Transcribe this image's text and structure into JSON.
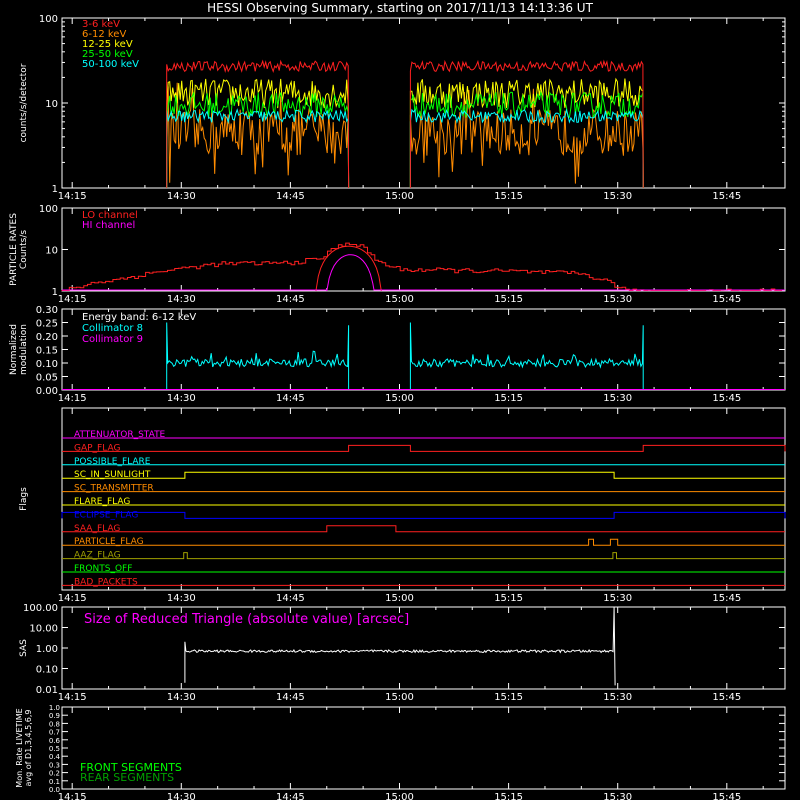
{
  "title": "HESSI Observing Summary, starting on 2017/11/13 14:13:36 UT",
  "colors": {
    "red": "#ff2020",
    "orange": "#ff8c00",
    "yellow": "#ffff00",
    "green": "#00ff00",
    "cyan": "#00ffff",
    "magenta": "#ff00ff",
    "blue": "#0000ff",
    "white": "#ffffff",
    "olive": "#a0a000",
    "darkgreen": "#00a000"
  },
  "time_ticks": [
    "14:15",
    "14:30",
    "14:45",
    "15:00",
    "15:15",
    "15:30",
    "15:45"
  ],
  "chart_data": [
    {
      "id": "countrates",
      "type": "line",
      "ylabel": "counts/s/detector",
      "y_scale": "log",
      "ylim": [
        1,
        100
      ],
      "xlim": [
        "14:13:36",
        "15:53:00"
      ],
      "y_ticks": [
        "1",
        "10",
        "100"
      ],
      "legend_placement": "top-left",
      "segments": [
        [
          "14:28:00",
          "14:53:00"
        ],
        [
          "15:01:30",
          "15:33:30"
        ]
      ],
      "series": [
        {
          "name": "3-6 keV",
          "color": "red",
          "level": 27
        },
        {
          "name": "6-12 keV",
          "color": "orange",
          "level": 4.5
        },
        {
          "name": "12-25 keV",
          "color": "yellow",
          "level": 13
        },
        {
          "name": "25-50 keV",
          "color": "green",
          "level": 9.5
        },
        {
          "name": "50-100 keV",
          "color": "cyan",
          "level": 7
        }
      ]
    },
    {
      "id": "particle",
      "type": "line",
      "ylabel": "PARTICLE RATES\nCounts/s",
      "y_scale": "log",
      "ylim": [
        1,
        100
      ],
      "y_ticks": [
        "1",
        "10",
        "100"
      ],
      "legend_placement": "top-left",
      "series": [
        {
          "name": "LO channel",
          "color": "red"
        },
        {
          "name": "HI channel",
          "color": "magenta"
        }
      ]
    },
    {
      "id": "modulation",
      "type": "line",
      "ylabel": "Normalized\nmodulation",
      "ylim": [
        0,
        0.3
      ],
      "y_ticks": [
        "0.00",
        "0.05",
        "0.10",
        "0.15",
        "0.20",
        "0.25",
        "0.30"
      ],
      "annotation": "Energy band: 6-12 keV",
      "legend_placement": "top-left",
      "series": [
        {
          "name": "Collimator 8",
          "color": "cyan",
          "level": 0.1
        },
        {
          "name": "Collimator 9",
          "color": "magenta",
          "level": 0.0
        }
      ]
    },
    {
      "id": "flags",
      "type": "line",
      "ylabel": "Flags",
      "flags": [
        {
          "name": "ATTENUATOR_STATE",
          "color": "magenta",
          "changes": []
        },
        {
          "name": "GAP_FLAG",
          "color": "red",
          "changes": [
            [
              "14:53:00",
              "15:01:30"
            ],
            [
              "15:33:30",
              "15:53:00"
            ]
          ]
        },
        {
          "name": "POSSIBLE_FLARE",
          "color": "cyan",
          "changes": []
        },
        {
          "name": "SC_IN_SUNLIGHT",
          "color": "yellow",
          "changes": [
            [
              "14:30:30",
              "15:29:30"
            ]
          ]
        },
        {
          "name": "SC_TRANSMITTER",
          "color": "orange",
          "changes": []
        },
        {
          "name": "FLARE_FLAG",
          "color": "yellow",
          "changes": []
        },
        {
          "name": "ECLIPSE_FLAG",
          "color": "blue",
          "changes": [
            [
              "14:13:36",
              "14:30:30"
            ],
            [
              "15:29:30",
              "15:53:00"
            ]
          ]
        },
        {
          "name": "SAA_FLAG",
          "color": "red",
          "changes": [
            [
              "14:50:00",
              "14:59:30"
            ]
          ]
        },
        {
          "name": "PARTICLE_FLAG",
          "color": "orange",
          "changes": [
            [
              "15:26:00",
              "15:26:40"
            ],
            [
              "15:29:00",
              "15:30:00"
            ]
          ]
        },
        {
          "name": "AAZ_FLAG",
          "color": "olive",
          "changes": [
            [
              "14:30:20",
              "14:30:50"
            ],
            [
              "15:29:20",
              "15:29:50"
            ]
          ]
        },
        {
          "name": "FRONTS_OFF",
          "color": "green",
          "changes": []
        },
        {
          "name": "BAD_PACKETS",
          "color": "red",
          "changes": []
        }
      ]
    },
    {
      "id": "sas",
      "type": "line",
      "ylabel": "SAS",
      "y_scale": "log",
      "ylim": [
        0.01,
        100
      ],
      "y_ticks": [
        "0.01",
        "0.10",
        "1.00",
        "10.00",
        "100.00"
      ],
      "annotation": "Size of Reduced Triangle (absolute value) [arcsec]",
      "segments": [
        [
          "14:30:30",
          "15:29:30"
        ]
      ],
      "level": 0.7
    },
    {
      "id": "livetime",
      "type": "line",
      "ylabel": "Mon. Rate LIVETIME\navg of D1,3,4,5,6,9",
      "ylim": [
        0,
        1
      ],
      "y_ticks": [
        "0.0",
        "0.1",
        "0.2",
        "0.3",
        "0.4",
        "0.5",
        "0.6",
        "0.7",
        "0.8",
        "0.9",
        "1.0"
      ],
      "legend_placement": "bottom-left",
      "series": [
        {
          "name": "FRONT SEGMENTS",
          "color": "green"
        },
        {
          "name": "REAR SEGMENTS",
          "color": "darkgreen"
        }
      ]
    }
  ]
}
